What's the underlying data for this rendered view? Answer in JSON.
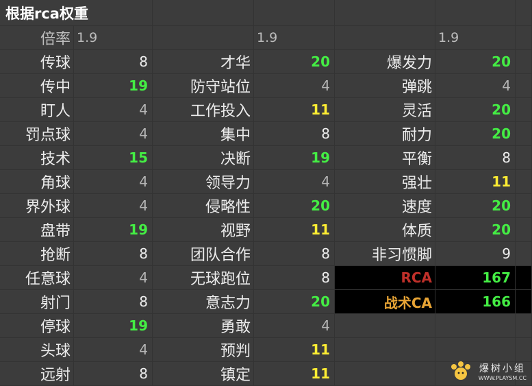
{
  "title": "根据rca权重",
  "multiplier": {
    "label": "倍率",
    "values": [
      "1.9",
      "1.9",
      "1.9"
    ]
  },
  "columns": [
    {
      "rows": [
        {
          "label": "传球",
          "value": "8"
        },
        {
          "label": "传中",
          "value": "19"
        },
        {
          "label": "盯人",
          "value": "4"
        },
        {
          "label": "罚点球",
          "value": "4"
        },
        {
          "label": "技术",
          "value": "15"
        },
        {
          "label": "角球",
          "value": "4"
        },
        {
          "label": "界外球",
          "value": "4"
        },
        {
          "label": "盘带",
          "value": "19"
        },
        {
          "label": "抢断",
          "value": "8"
        },
        {
          "label": "任意球",
          "value": "4"
        },
        {
          "label": "射门",
          "value": "8"
        },
        {
          "label": "停球",
          "value": "19"
        },
        {
          "label": "头球",
          "value": "4"
        },
        {
          "label": "远射",
          "value": "8"
        }
      ]
    },
    {
      "rows": [
        {
          "label": "才华",
          "value": "20"
        },
        {
          "label": "防守站位",
          "value": "4"
        },
        {
          "label": "工作投入",
          "value": "11"
        },
        {
          "label": "集中",
          "value": "8"
        },
        {
          "label": "决断",
          "value": "19"
        },
        {
          "label": "领导力",
          "value": "4"
        },
        {
          "label": "侵略性",
          "value": "20"
        },
        {
          "label": "视野",
          "value": "11"
        },
        {
          "label": "团队合作",
          "value": "8"
        },
        {
          "label": "无球跑位",
          "value": "8"
        },
        {
          "label": "意志力",
          "value": "20"
        },
        {
          "label": "勇敢",
          "value": "4"
        },
        {
          "label": "预判",
          "value": "11"
        },
        {
          "label": "镇定",
          "value": "11"
        }
      ]
    },
    {
      "rows": [
        {
          "label": "爆发力",
          "value": "20"
        },
        {
          "label": "弹跳",
          "value": "4"
        },
        {
          "label": "灵活",
          "value": "20"
        },
        {
          "label": "耐力",
          "value": "20"
        },
        {
          "label": "平衡",
          "value": "8"
        },
        {
          "label": "强壮",
          "value": "11"
        },
        {
          "label": "速度",
          "value": "20"
        },
        {
          "label": "体质",
          "value": "20"
        },
        {
          "label": "非习惯脚",
          "value": "9"
        }
      ]
    }
  ],
  "summary": {
    "rca_label": "RCA",
    "rca_value": "167",
    "ca_label": "战术CA",
    "ca_value": "166"
  },
  "colors": {
    "background": "#3c3c3c",
    "value_high": "#44ee44",
    "value_yellow": "#ffee33",
    "value_low": "#b5b5b5",
    "rca_label": "#c0302a",
    "ca_label": "#e8a435"
  },
  "watermark": {
    "logo_icon": "pawprint-logo-icon",
    "name": "爆树小组",
    "url": "WWW.PLAYSM.CC"
  }
}
